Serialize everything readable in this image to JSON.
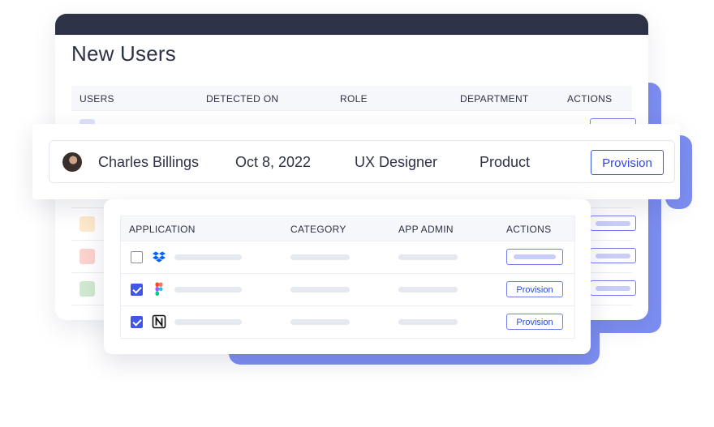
{
  "main": {
    "title": "New Users",
    "columns": [
      "USERS",
      "DETECTED ON",
      "ROLE",
      "DEPARTMENT",
      "ACTIONS"
    ],
    "row_swatch_colors": [
      "#dfe1fb",
      "#e6e8ef",
      "#e6e8ef",
      "#fde9cc",
      "#fbd2cc",
      "#cfe8cf"
    ]
  },
  "highlight_user": {
    "name": "Charles Billings",
    "detected_on": "Oct 8, 2022",
    "role": "UX Designer",
    "department": "Product",
    "action_label": "Provision"
  },
  "apps": {
    "columns": [
      "APPLICATION",
      "CATEGORY",
      "APP ADMIN",
      "ACTIONS"
    ],
    "rows": [
      {
        "icon": "dropbox-icon",
        "checked": false,
        "action_label": ""
      },
      {
        "icon": "figma-icon",
        "checked": true,
        "action_label": "Provision"
      },
      {
        "icon": "notion-icon",
        "checked": true,
        "action_label": "Provision"
      }
    ]
  },
  "colors": {
    "accent": "#7d8ef2",
    "header_dark": "#2e3247",
    "button_blue": "#3f57e3"
  }
}
